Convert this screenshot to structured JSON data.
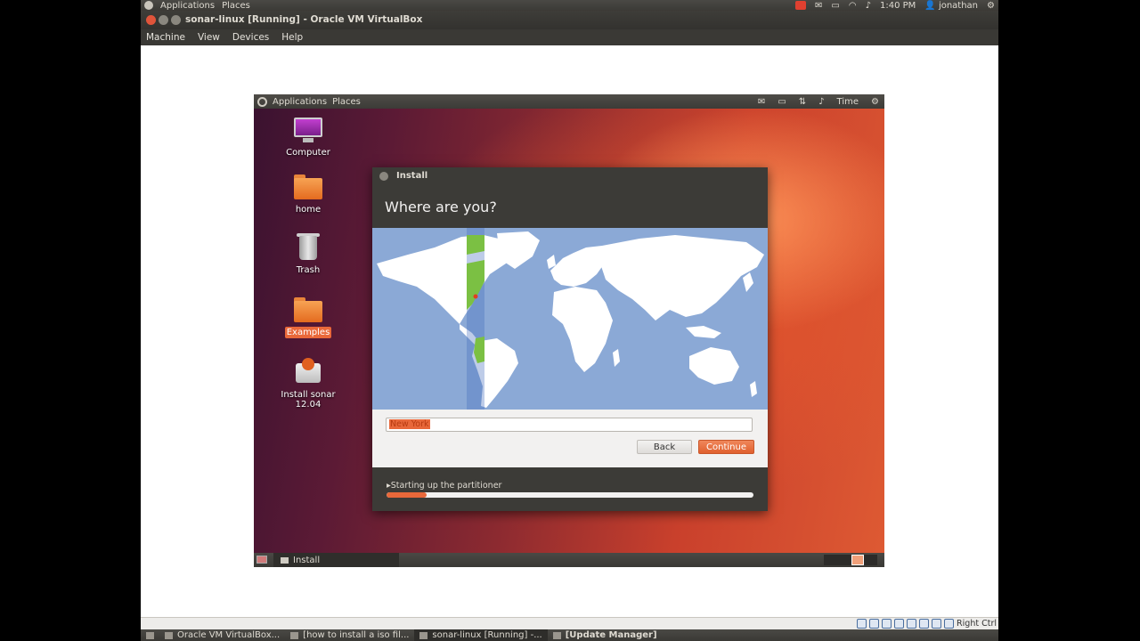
{
  "host": {
    "top_panel": {
      "applications": "Applications",
      "places": "Places",
      "clock": "1:40 PM",
      "user": "jonathan"
    },
    "vbox": {
      "title": "sonar-linux [Running] - Oracle VM VirtualBox",
      "menu": [
        "Machine",
        "View",
        "Devices",
        "Help"
      ],
      "status_right": "Right Ctrl"
    },
    "taskbar": [
      {
        "label": "Oracle VM VirtualBox...",
        "active": false
      },
      {
        "label": "[how to install a iso fil...",
        "active": false
      },
      {
        "label": "sonar-linux [Running] -...",
        "active": true
      },
      {
        "label": "[Update Manager]",
        "active": false
      }
    ]
  },
  "guest": {
    "top_panel": {
      "applications": "Applications",
      "places": "Places",
      "time": "Time"
    },
    "desktop_icons": [
      {
        "label": "Computer",
        "selected": false
      },
      {
        "label": "home",
        "selected": false
      },
      {
        "label": "Trash",
        "selected": false
      },
      {
        "label": "Examples",
        "selected": true
      },
      {
        "label": "Install sonar 12.04",
        "selected": false
      }
    ],
    "install": {
      "window_title": "Install",
      "heading": "Where are you?",
      "location_value": "New York",
      "back_label": "Back",
      "continue_label": "Continue",
      "progress_text": "Starting up the partitioner",
      "progress_fraction": 0.11
    },
    "taskbar_item": "Install"
  },
  "colors": {
    "accent": "#e8683a",
    "panel": "#3c3b37",
    "map_ocean": "#8ba9d6",
    "land": "#ffffff",
    "tz_land": "#7bc043"
  },
  "icons": [
    "ubuntu-logo-icon",
    "mail-icon",
    "battery-icon",
    "wifi-icon",
    "volume-icon",
    "user-icon",
    "gear-icon",
    "network-icon",
    "computer-icon",
    "folder-icon",
    "trash-icon",
    "installer-icon"
  ]
}
